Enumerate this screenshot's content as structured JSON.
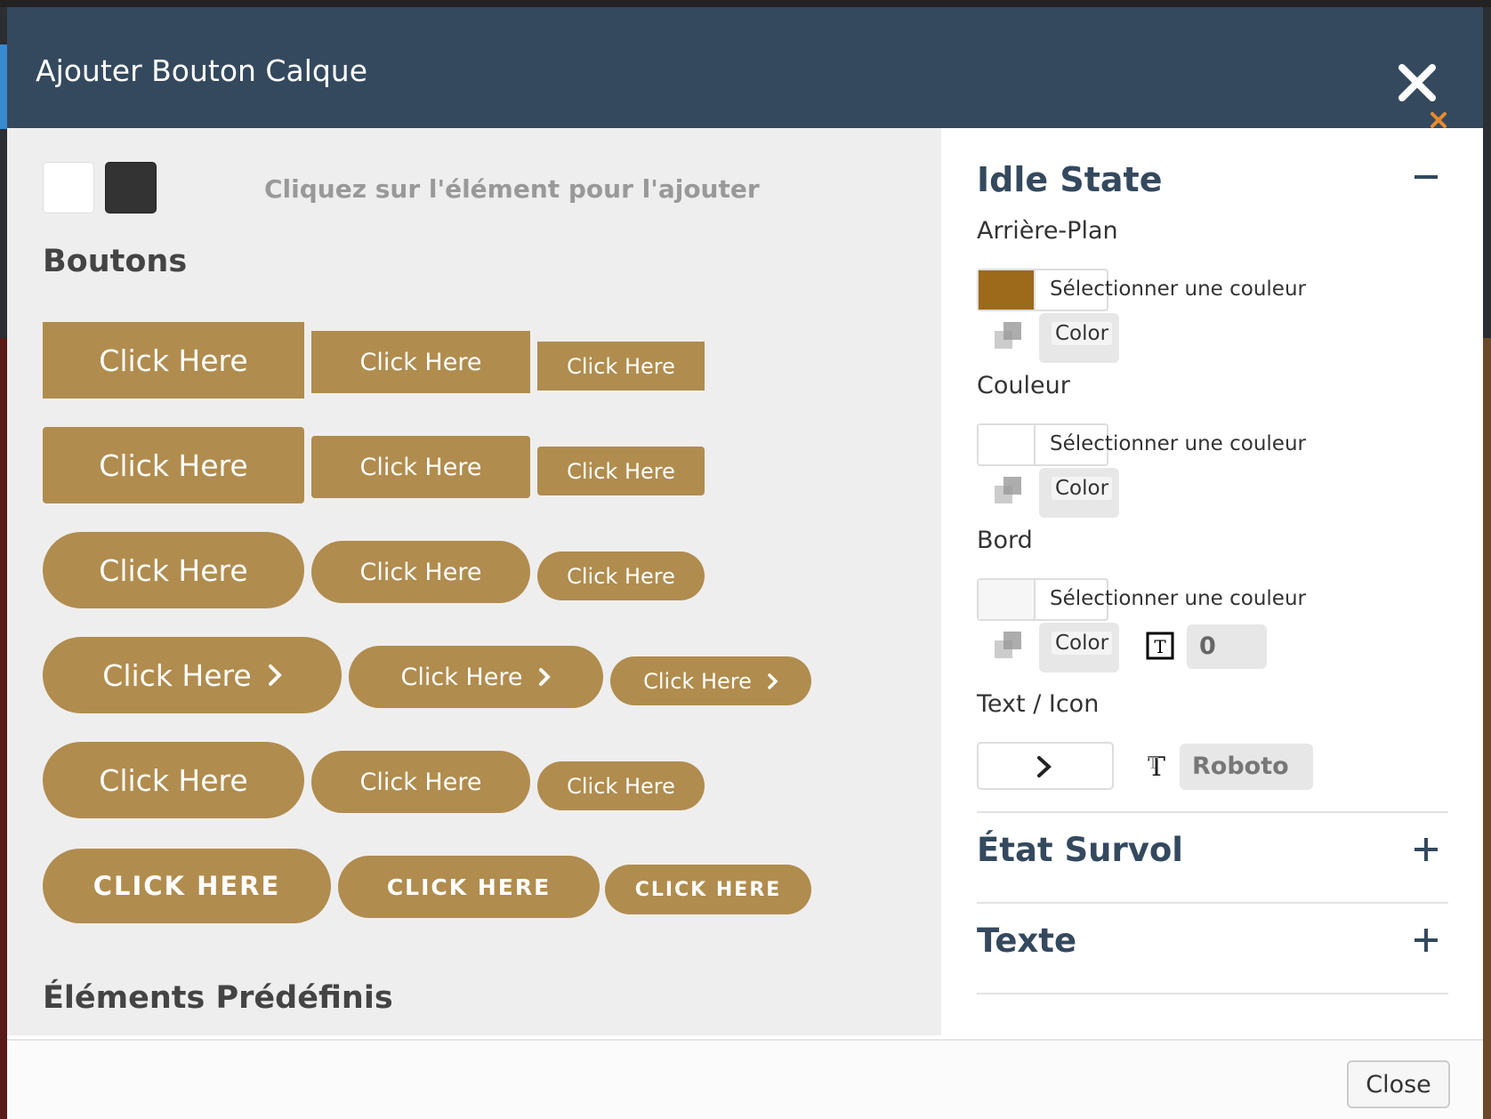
{
  "modal": {
    "title": "Ajouter Bouton Calque",
    "close_label": "Close"
  },
  "left": {
    "hint": "Cliquez sur l'élément pour l'ajouter",
    "section_buttons": "Boutons",
    "section_predefined": "Éléments Prédéfinis",
    "button_rows": [
      {
        "labels": [
          "Click Here",
          "Click Here",
          "Click Here"
        ]
      },
      {
        "labels": [
          "Click Here",
          "Click Here",
          "Click Here"
        ]
      },
      {
        "labels": [
          "Click Here",
          "Click Here",
          "Click Here"
        ]
      },
      {
        "labels": [
          "Click Here",
          "Click Here",
          "Click Here"
        ]
      },
      {
        "labels": [
          "Click Here",
          "Click Here",
          "Click Here"
        ]
      },
      {
        "labels": [
          "CLICK HERE",
          "CLICK HERE",
          "CLICK HERE"
        ]
      }
    ]
  },
  "right": {
    "idle_title": "Idle State",
    "background_label": "Arrière-Plan",
    "color_label": "Couleur",
    "border_label": "Bord",
    "text_icon_label": "Text / Icon",
    "picker_text": "Sélectionner une couleur",
    "color_field": "Color",
    "border_width": "0",
    "font": "Roboto",
    "hover_title": "État Survol",
    "text_title": "Texte",
    "colors": {
      "background": "#9c6a1a",
      "text": "#ffffff",
      "border": "#f6f6f6",
      "button": "#b08c4e"
    }
  }
}
